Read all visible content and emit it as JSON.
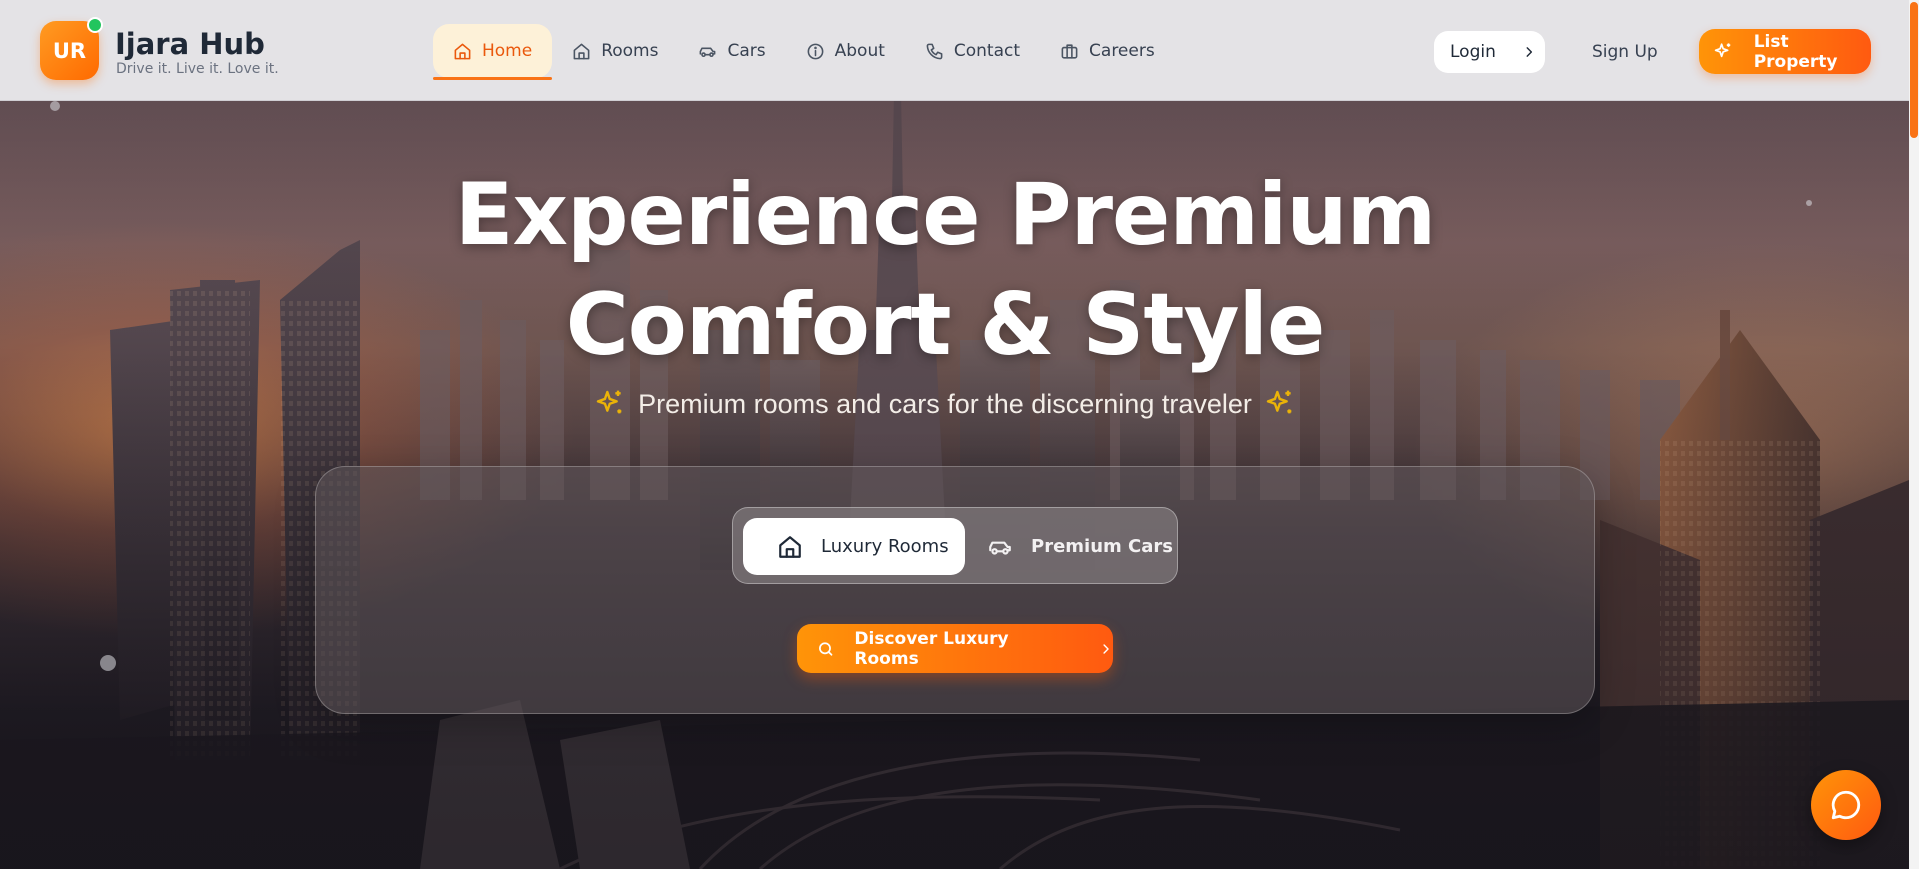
{
  "brand": {
    "badge": "UR",
    "name": "Ijara Hub",
    "tagline": "Drive it. Live it. Love it."
  },
  "nav": {
    "items": [
      {
        "label": "Home",
        "icon": "home-icon",
        "active": true
      },
      {
        "label": "Rooms",
        "icon": "home-icon",
        "active": false
      },
      {
        "label": "Cars",
        "icon": "car-icon",
        "active": false
      },
      {
        "label": "About",
        "icon": "info-icon",
        "active": false
      },
      {
        "label": "Contact",
        "icon": "phone-icon",
        "active": false
      },
      {
        "label": "Careers",
        "icon": "briefcase-icon",
        "active": false
      }
    ]
  },
  "auth": {
    "login_label": "Login",
    "signup_label": "Sign Up",
    "list_property_label": "List Property"
  },
  "hero": {
    "title_line1": "Experience Premium",
    "title_line2": "Comfort & Style",
    "subtitle": "Premium rooms and cars for the discerning traveler",
    "toggle": {
      "rooms_label": "Luxury Rooms",
      "cars_label": "Premium Cars",
      "selected": "Luxury Rooms"
    },
    "cta_label": "Discover Luxury Rooms"
  },
  "colors": {
    "accent": "#f97316",
    "accent_gradient_start": "#ff9408",
    "accent_gradient_end": "#ff5a10",
    "online_dot": "#22c55e",
    "header_bg": "#e4e3e6"
  }
}
